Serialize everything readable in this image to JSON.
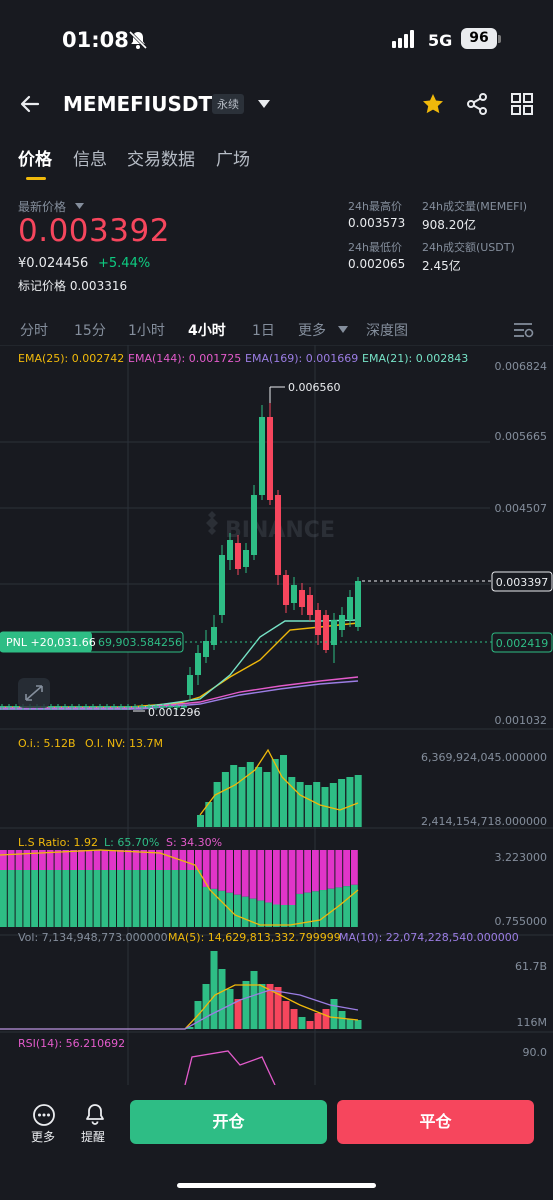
{
  "status_bar": {
    "time": "01:08",
    "network": "5G",
    "battery": "96"
  },
  "header": {
    "symbol": "MEMEFIUSDT",
    "contract_type": "永续"
  },
  "tabs": [
    "价格",
    "信息",
    "交易数据",
    "广场"
  ],
  "price": {
    "latest_label": "最新价格",
    "last": "0.003392",
    "cny": "¥0.024456",
    "change_pct": "+5.44%",
    "mark_label": "标记价格",
    "mark": "0.003316"
  },
  "stats": {
    "high_label": "24h最高价",
    "high": "0.003573",
    "low_label": "24h最低价",
    "low": "0.002065",
    "vol_base_label": "24h成交量(MEMEFI)",
    "vol_base": "908.20亿",
    "vol_quote_label": "24h成交额(USDT)",
    "vol_quote": "2.45亿"
  },
  "intervals": [
    "分时",
    "15分",
    "1小时",
    "4小时",
    "1日",
    "更多",
    "深度图"
  ],
  "active_interval": "4小时",
  "chart": {
    "ema25": "EMA(25): 0.002742",
    "ema144": "EMA(144): 0.001725",
    "ema169": "EMA(169): 0.001669",
    "ema21": "EMA(21): 0.002843",
    "axis": [
      "0.006824",
      "0.005665",
      "0.004507",
      "0.003397",
      "0.002419",
      "0.001032"
    ],
    "high_marker": "0.006560",
    "low_marker": "0.001296",
    "pnl": "PNL +20,031.66",
    "position_size": "69,903.584256",
    "watermark": "BINANCE",
    "oi_label": "O.i.: 5.12B",
    "oi_nv_label": "O.I. NV: 13.7M",
    "oi_axis_top": "6,369,924,045.000000",
    "oi_axis_bottom": "2,414,154,718.000000",
    "ls_label": "L.S Ratio: 1.92",
    "ls_long": "L: 65.70%",
    "ls_short": "S: 34.30%",
    "ls_axis_top": "3.223000",
    "ls_axis_bottom": "0.755000",
    "vol_label": "Vol: 7,134,948,773.000000",
    "ma5_label": "MA(5): 14,629,813,332.799999",
    "ma10_label": "MA(10): 22,074,228,540.000000",
    "vol_axis_top": "61.7B",
    "vol_axis_bottom": "116M",
    "rsi_label": "RSI(14): 56.210692",
    "rsi_axis_top": "90.0"
  },
  "bottom": {
    "more": "更多",
    "remind": "提醒",
    "open": "开仓",
    "close": "平仓"
  },
  "colors": {
    "up": "#2ebd85",
    "down": "#f6465d",
    "accent": "#f0b90b",
    "background": "#181a20"
  }
}
